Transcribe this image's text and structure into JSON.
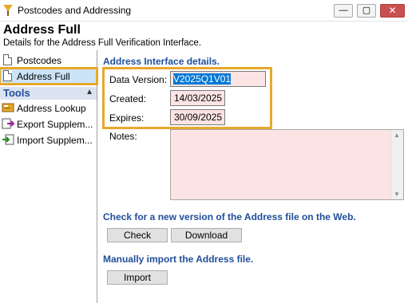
{
  "window": {
    "title": "Postcodes and Addressing",
    "minimize_glyph": "—",
    "maximize_glyph": "▢",
    "close_glyph": "✕"
  },
  "header": {
    "title": "Address Full",
    "subtitle": "Details for the Address Full Verification Interface."
  },
  "sidebar": {
    "items": [
      {
        "label": "Postcodes",
        "icon": "document-icon"
      },
      {
        "label": "Address Full",
        "icon": "document-icon",
        "selected": true
      }
    ],
    "tools_header": "Tools",
    "tools_caret": "▲",
    "tools": [
      {
        "label": "Address Lookup",
        "icon": "address-lookup-icon"
      },
      {
        "label": "Export Supplem...",
        "icon": "export-icon"
      },
      {
        "label": "Import Supplem...",
        "icon": "import-icon"
      }
    ]
  },
  "main": {
    "section_title": "Address Interface details.",
    "data_version_label": "Data Version:",
    "data_version_value": "V2025Q1V01",
    "created_label": "Created:",
    "created_value": "14/03/2025",
    "expires_label": "Expires:",
    "expires_value": "30/09/2025",
    "notes_label": "Notes:",
    "notes_value": "",
    "check_title": "Check for a new version of the Address file on the Web.",
    "check_button": "Check",
    "download_button": "Download",
    "import_title": "Manually import the Address file.",
    "import_button": "Import"
  },
  "colors": {
    "accent_blue": "#1f4e9a",
    "highlight_orange": "#e8a82a",
    "field_bg": "#fde4e4",
    "selection": "#0078d7"
  }
}
